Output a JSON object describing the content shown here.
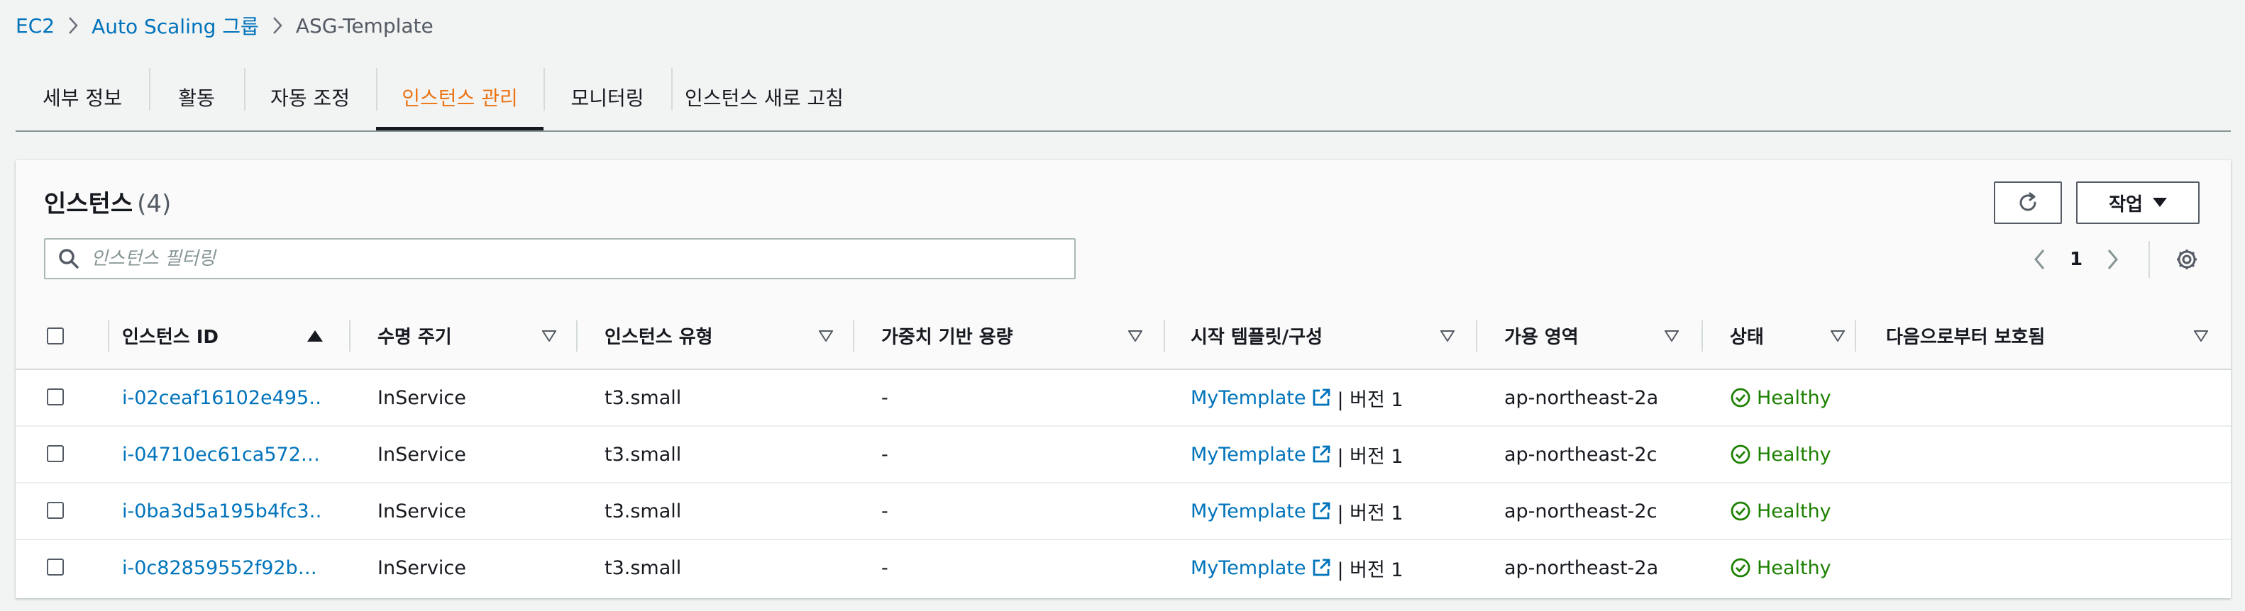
{
  "breadcrumb": {
    "items": [
      "EC2",
      "Auto Scaling 그룹"
    ],
    "current": "ASG-Template"
  },
  "tabs": [
    "세부 정보",
    "활동",
    "자동 조정",
    "인스턴스 관리",
    "모니터링",
    "인스턴스 새로 고침"
  ],
  "active_tab": "인스턴스 관리",
  "panel": {
    "title": "인스턴스",
    "count": "(4)",
    "action_button": "작업",
    "search_placeholder": "인스턴스 필터링",
    "page": "1"
  },
  "table": {
    "columns": [
      "인스턴스 ID",
      "수명 주기",
      "인스턴스 유형",
      "가중치 기반 용량",
      "시작 템플릿/구성",
      "가용 영역",
      "상태",
      "다음으로부터 보호됨"
    ],
    "sorted_column": "인스턴스 ID",
    "rows": [
      {
        "id": "i-02ceaf16102e495…",
        "lifecycle": "InService",
        "type": "t3.small",
        "weight": "-",
        "template": "MyTemplate",
        "version": "| 버전 1",
        "zone": "ap-northeast-2a",
        "status": "Healthy",
        "protected": ""
      },
      {
        "id": "i-04710ec61ca572…",
        "lifecycle": "InService",
        "type": "t3.small",
        "weight": "-",
        "template": "MyTemplate",
        "version": "| 버전 1",
        "zone": "ap-northeast-2c",
        "status": "Healthy",
        "protected": ""
      },
      {
        "id": "i-0ba3d5a195b4fc3…",
        "lifecycle": "InService",
        "type": "t3.small",
        "weight": "-",
        "template": "MyTemplate",
        "version": "| 버전 1",
        "zone": "ap-northeast-2c",
        "status": "Healthy",
        "protected": ""
      },
      {
        "id": "i-0c82859552f92b…",
        "lifecycle": "InService",
        "type": "t3.small",
        "weight": "-",
        "template": "MyTemplate",
        "version": "| 버전 1",
        "zone": "ap-northeast-2a",
        "status": "Healthy",
        "protected": ""
      }
    ]
  },
  "icons": {
    "refresh": "refresh-icon",
    "dropdown": "caret-down-icon",
    "search": "search-icon",
    "prev": "chevron-left-icon",
    "next": "chevron-right-icon",
    "settings": "gear-icon",
    "external": "external-link-icon",
    "status": "check-circle-icon"
  },
  "colors": {
    "link": "#0073bb",
    "active_tab": "#ec7211",
    "healthy": "#1d8102",
    "background": "#f2f3f3"
  }
}
